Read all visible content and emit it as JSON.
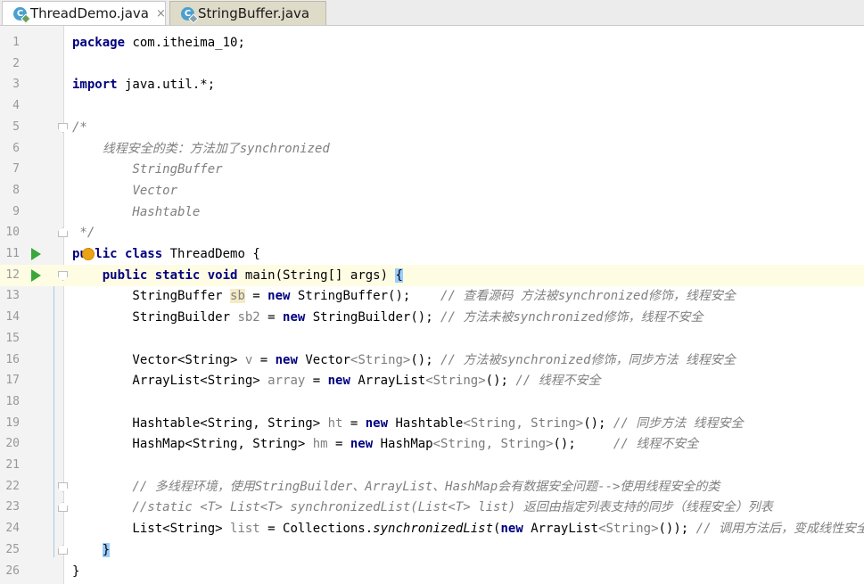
{
  "tabs": [
    {
      "label": "ThreadDemo.java",
      "close": "×",
      "icon": "java-class-icon"
    },
    {
      "label": "StringBuffer.java",
      "icon": "java-class-icon"
    }
  ],
  "editor": {
    "lines": [
      {
        "num": "1",
        "tokens": [
          {
            "t": "package",
            "c": "kw"
          },
          {
            "t": " com.itheima_10;"
          }
        ]
      },
      {
        "num": "2",
        "tokens": []
      },
      {
        "num": "3",
        "tokens": [
          {
            "t": "import",
            "c": "kw"
          },
          {
            "t": " java.util.*;"
          }
        ]
      },
      {
        "num": "4",
        "tokens": []
      },
      {
        "num": "5",
        "fold": "start",
        "tokens": [
          {
            "t": "/*",
            "c": "cm"
          }
        ]
      },
      {
        "num": "6",
        "tokens": [
          {
            "t": "    线程安全的类：方法加了synchronized",
            "c": "cm"
          }
        ]
      },
      {
        "num": "7",
        "tokens": [
          {
            "t": "        StringBuffer",
            "c": "cm"
          }
        ]
      },
      {
        "num": "8",
        "tokens": [
          {
            "t": "        Vector",
            "c": "cm"
          }
        ]
      },
      {
        "num": "9",
        "tokens": [
          {
            "t": "        Hashtable",
            "c": "cm"
          }
        ]
      },
      {
        "num": "10",
        "fold": "end",
        "tokens": [
          {
            "t": " */",
            "c": "cm"
          }
        ]
      },
      {
        "num": "11",
        "run": true,
        "bulb": true,
        "tokens": [
          {
            "t": "public",
            "c": "kw"
          },
          {
            "t": " "
          },
          {
            "t": "class",
            "c": "kw"
          },
          {
            "t": " ThreadDemo {"
          }
        ]
      },
      {
        "num": "12",
        "run": true,
        "fold": "start",
        "current": true,
        "tokens": [
          {
            "t": "    "
          },
          {
            "t": "public",
            "c": "kw"
          },
          {
            "t": " "
          },
          {
            "t": "static",
            "c": "kw"
          },
          {
            "t": " "
          },
          {
            "t": "void",
            "c": "kw"
          },
          {
            "t": " main(String[] args) "
          },
          {
            "t": "{",
            "c": "brace-hl"
          }
        ]
      },
      {
        "num": "13",
        "tokens": [
          {
            "t": "        StringBuffer "
          },
          {
            "t": "sb",
            "c": "unused hl"
          },
          {
            "t": " = "
          },
          {
            "t": "new",
            "c": "kw"
          },
          {
            "t": " StringBuffer();    "
          },
          {
            "t": "// 查看源码 方法被synchronized修饰，线程安全",
            "c": "cm"
          }
        ]
      },
      {
        "num": "14",
        "tokens": [
          {
            "t": "        StringBuilder "
          },
          {
            "t": "sb2",
            "c": "unused"
          },
          {
            "t": " = "
          },
          {
            "t": "new",
            "c": "kw"
          },
          {
            "t": " StringBuilder(); "
          },
          {
            "t": "// 方法未被synchronized修饰，线程不安全",
            "c": "cm"
          }
        ]
      },
      {
        "num": "15",
        "tokens": []
      },
      {
        "num": "16",
        "tokens": [
          {
            "t": "        Vector<String> "
          },
          {
            "t": "v",
            "c": "unused"
          },
          {
            "t": " = "
          },
          {
            "t": "new",
            "c": "kw"
          },
          {
            "t": " Vector"
          },
          {
            "t": "<String>",
            "c": "gen"
          },
          {
            "t": "(); "
          },
          {
            "t": "// 方法被synchronized修饰，同步方法 线程安全",
            "c": "cm"
          }
        ]
      },
      {
        "num": "17",
        "tokens": [
          {
            "t": "        ArrayList<String> "
          },
          {
            "t": "array",
            "c": "unused"
          },
          {
            "t": " = "
          },
          {
            "t": "new",
            "c": "kw"
          },
          {
            "t": " ArrayList"
          },
          {
            "t": "<String>",
            "c": "gen"
          },
          {
            "t": "(); "
          },
          {
            "t": "// 线程不安全",
            "c": "cm"
          }
        ]
      },
      {
        "num": "18",
        "tokens": []
      },
      {
        "num": "19",
        "tokens": [
          {
            "t": "        Hashtable<String, String> "
          },
          {
            "t": "ht",
            "c": "unused"
          },
          {
            "t": " = "
          },
          {
            "t": "new",
            "c": "kw"
          },
          {
            "t": " Hashtable"
          },
          {
            "t": "<String, String>",
            "c": "gen"
          },
          {
            "t": "(); "
          },
          {
            "t": "// 同步方法 线程安全",
            "c": "cm"
          }
        ]
      },
      {
        "num": "20",
        "tokens": [
          {
            "t": "        HashMap<String, String> "
          },
          {
            "t": "hm",
            "c": "unused"
          },
          {
            "t": " = "
          },
          {
            "t": "new",
            "c": "kw"
          },
          {
            "t": " HashMap"
          },
          {
            "t": "<String, String>",
            "c": "gen"
          },
          {
            "t": "();     "
          },
          {
            "t": "// 线程不安全",
            "c": "cm"
          }
        ]
      },
      {
        "num": "21",
        "tokens": []
      },
      {
        "num": "22",
        "fold": "start",
        "tokens": [
          {
            "t": "        // 多线程环境，使用StringBuilder、ArrayList、HashMap会有数据安全问题-->使用线程安全的类",
            "c": "cm"
          }
        ]
      },
      {
        "num": "23",
        "fold": "end",
        "tokens": [
          {
            "t": "        //static <T> List<T> synchronizedList(List<T> list) 返回由指定列表支持的同步（线程安全）列表",
            "c": "cm"
          }
        ]
      },
      {
        "num": "24",
        "tokens": [
          {
            "t": "        List<String> "
          },
          {
            "t": "list",
            "c": "unused"
          },
          {
            "t": " = Collections."
          },
          {
            "t": "synchronizedList",
            "c": "mcall"
          },
          {
            "t": "("
          },
          {
            "t": "new",
            "c": "kw"
          },
          {
            "t": " ArrayList"
          },
          {
            "t": "<String>",
            "c": "gen"
          },
          {
            "t": "()); "
          },
          {
            "t": "// 调用方法后，变成线性安全类",
            "c": "cm"
          }
        ]
      },
      {
        "num": "25",
        "fold": "end",
        "tokens": [
          {
            "t": "    "
          },
          {
            "t": "}",
            "c": "brace-hl"
          }
        ]
      },
      {
        "num": "26",
        "tokens": [
          {
            "t": "}"
          }
        ]
      }
    ]
  }
}
